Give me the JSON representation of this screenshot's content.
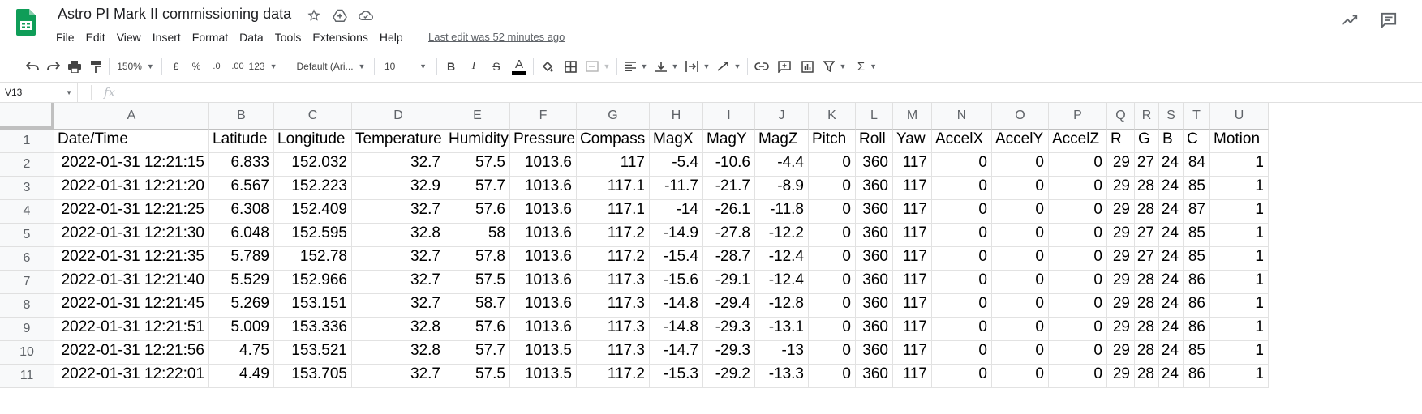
{
  "doc": {
    "title": "Astro PI Mark II commissioning data",
    "last_edit": "Last edit was 52 minutes ago",
    "menu": [
      "File",
      "Edit",
      "View",
      "Insert",
      "Format",
      "Data",
      "Tools",
      "Extensions",
      "Help"
    ],
    "brand_color": "#0f9d58"
  },
  "toolbar": {
    "zoom": "150%",
    "currency": "£",
    "percent": "%",
    "dec_decrease": ".0",
    "dec_increase": ".00",
    "more_formats": "123",
    "font": "Default (Ari...",
    "font_size": "10",
    "bold": "B",
    "italic": "I",
    "strike": "S",
    "text_color": "A",
    "sigma": "Σ"
  },
  "formula_bar": {
    "cell_ref": "V13",
    "fx": "fx"
  },
  "columns": [
    "A",
    "B",
    "C",
    "D",
    "E",
    "F",
    "G",
    "H",
    "I",
    "J",
    "K",
    "L",
    "M",
    "N",
    "O",
    "P",
    "Q",
    "R",
    "S",
    "T",
    "U"
  ],
  "headers": [
    "Date/Time",
    "Latitude",
    "Longitude",
    "Temperature",
    "Humidity",
    "Pressure",
    "Compass",
    "MagX",
    "MagY",
    "MagZ",
    "Pitch",
    "Roll",
    "Yaw",
    "AccelX",
    "AccelY",
    "AccelZ",
    "R",
    "G",
    "B",
    "C",
    "Motion"
  ],
  "row_numbers": [
    "1",
    "2",
    "3",
    "4",
    "5",
    "6",
    "7",
    "8",
    "9",
    "10",
    "11"
  ],
  "rows": [
    [
      "2022-01-31 12:21:15",
      "6.833",
      "152.032",
      "32.7",
      "57.5",
      "1013.6",
      "117",
      "-5.4",
      "-10.6",
      "-4.4",
      "0",
      "360",
      "117",
      "0",
      "0",
      "0",
      "29",
      "27",
      "24",
      "84",
      "1"
    ],
    [
      "2022-01-31 12:21:20",
      "6.567",
      "152.223",
      "32.9",
      "57.7",
      "1013.6",
      "117.1",
      "-11.7",
      "-21.7",
      "-8.9",
      "0",
      "360",
      "117",
      "0",
      "0",
      "0",
      "29",
      "28",
      "24",
      "85",
      "1"
    ],
    [
      "2022-01-31 12:21:25",
      "6.308",
      "152.409",
      "32.7",
      "57.6",
      "1013.6",
      "117.1",
      "-14",
      "-26.1",
      "-11.8",
      "0",
      "360",
      "117",
      "0",
      "0",
      "0",
      "29",
      "28",
      "24",
      "87",
      "1"
    ],
    [
      "2022-01-31 12:21:30",
      "6.048",
      "152.595",
      "32.8",
      "58",
      "1013.6",
      "117.2",
      "-14.9",
      "-27.8",
      "-12.2",
      "0",
      "360",
      "117",
      "0",
      "0",
      "0",
      "29",
      "27",
      "24",
      "85",
      "1"
    ],
    [
      "2022-01-31 12:21:35",
      "5.789",
      "152.78",
      "32.7",
      "57.8",
      "1013.6",
      "117.2",
      "-15.4",
      "-28.7",
      "-12.4",
      "0",
      "360",
      "117",
      "0",
      "0",
      "0",
      "29",
      "27",
      "24",
      "85",
      "1"
    ],
    [
      "2022-01-31 12:21:40",
      "5.529",
      "152.966",
      "32.7",
      "57.5",
      "1013.6",
      "117.3",
      "-15.6",
      "-29.1",
      "-12.4",
      "0",
      "360",
      "117",
      "0",
      "0",
      "0",
      "29",
      "28",
      "24",
      "86",
      "1"
    ],
    [
      "2022-01-31 12:21:45",
      "5.269",
      "153.151",
      "32.7",
      "58.7",
      "1013.6",
      "117.3",
      "-14.8",
      "-29.4",
      "-12.8",
      "0",
      "360",
      "117",
      "0",
      "0",
      "0",
      "29",
      "28",
      "24",
      "86",
      "1"
    ],
    [
      "2022-01-31 12:21:51",
      "5.009",
      "153.336",
      "32.8",
      "57.6",
      "1013.6",
      "117.3",
      "-14.8",
      "-29.3",
      "-13.1",
      "0",
      "360",
      "117",
      "0",
      "0",
      "0",
      "29",
      "28",
      "24",
      "86",
      "1"
    ],
    [
      "2022-01-31 12:21:56",
      "4.75",
      "153.521",
      "32.8",
      "57.7",
      "1013.5",
      "117.3",
      "-14.7",
      "-29.3",
      "-13",
      "0",
      "360",
      "117",
      "0",
      "0",
      "0",
      "29",
      "28",
      "24",
      "85",
      "1"
    ],
    [
      "2022-01-31 12:22:01",
      "4.49",
      "153.705",
      "32.7",
      "57.5",
      "1013.5",
      "117.2",
      "-15.3",
      "-29.2",
      "-13.3",
      "0",
      "360",
      "117",
      "0",
      "0",
      "0",
      "29",
      "28",
      "24",
      "86",
      "1"
    ]
  ]
}
